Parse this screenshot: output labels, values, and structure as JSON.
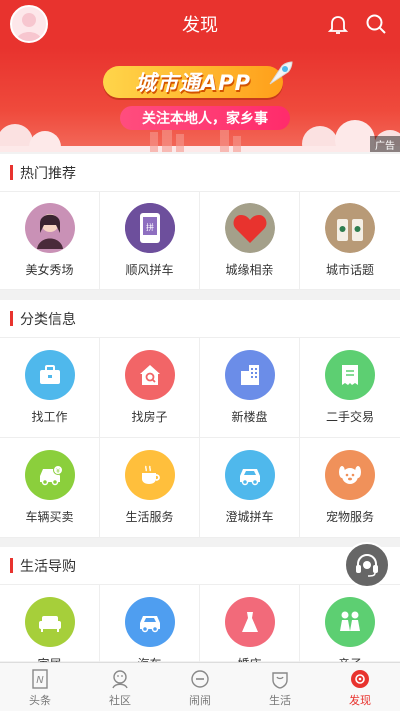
{
  "header": {
    "title": "发现"
  },
  "banner": {
    "logo_text": "城市通APP",
    "slogan": "关注本地人，家乡事",
    "ad_tag": "广告"
  },
  "sections": [
    {
      "title": "热门推荐",
      "items": [
        {
          "label": "美女秀场",
          "icon": "beauty-show-icon",
          "color": "#d8a8c8"
        },
        {
          "label": "顺风拼车",
          "icon": "carpool-icon",
          "color": "#7a59a8"
        },
        {
          "label": "城缘相亲",
          "icon": "heart-date-icon",
          "color": "#e8332e"
        },
        {
          "label": "城市话题",
          "icon": "coffee-topic-icon",
          "color": "#8a6b4a"
        }
      ]
    },
    {
      "title": "分类信息",
      "items": [
        {
          "label": "找工作",
          "icon": "briefcase-icon",
          "color": "#4fb8ec"
        },
        {
          "label": "找房子",
          "icon": "house-search-icon",
          "color": "#f26567"
        },
        {
          "label": "新楼盘",
          "icon": "building-icon",
          "color": "#6b8de8"
        },
        {
          "label": "二手交易",
          "icon": "receipt-icon",
          "color": "#5dcf72"
        },
        {
          "label": "车辆买卖",
          "icon": "car-sale-icon",
          "color": "#8bcf3c"
        },
        {
          "label": "生活服务",
          "icon": "coffee-cup-icon",
          "color": "#ffbf3c"
        },
        {
          "label": "澄城拼车",
          "icon": "taxi-icon",
          "color": "#4fb8ec"
        },
        {
          "label": "宠物服务",
          "icon": "dog-icon",
          "color": "#f0915a"
        }
      ]
    },
    {
      "title": "生活导购",
      "items": [
        {
          "label": "家居",
          "icon": "sofa-icon",
          "color": "#a6cf3a"
        },
        {
          "label": "汽车",
          "icon": "car-icon",
          "color": "#4f9ef0"
        },
        {
          "label": "婚庆",
          "icon": "dress-icon",
          "color": "#f26a7a"
        },
        {
          "label": "亲子",
          "icon": "parent-child-icon",
          "color": "#5dcf72"
        }
      ]
    }
  ],
  "bottom_nav": [
    {
      "label": "头条",
      "icon": "news-icon",
      "active": false
    },
    {
      "label": "社区",
      "icon": "community-icon",
      "active": false
    },
    {
      "label": "闹闹",
      "icon": "chat-icon",
      "active": false
    },
    {
      "label": "生活",
      "icon": "life-icon",
      "active": false
    },
    {
      "label": "发现",
      "icon": "discover-icon",
      "active": true
    }
  ],
  "colors": {
    "brand": "#e8332e",
    "active_nav": "#e8332e"
  }
}
